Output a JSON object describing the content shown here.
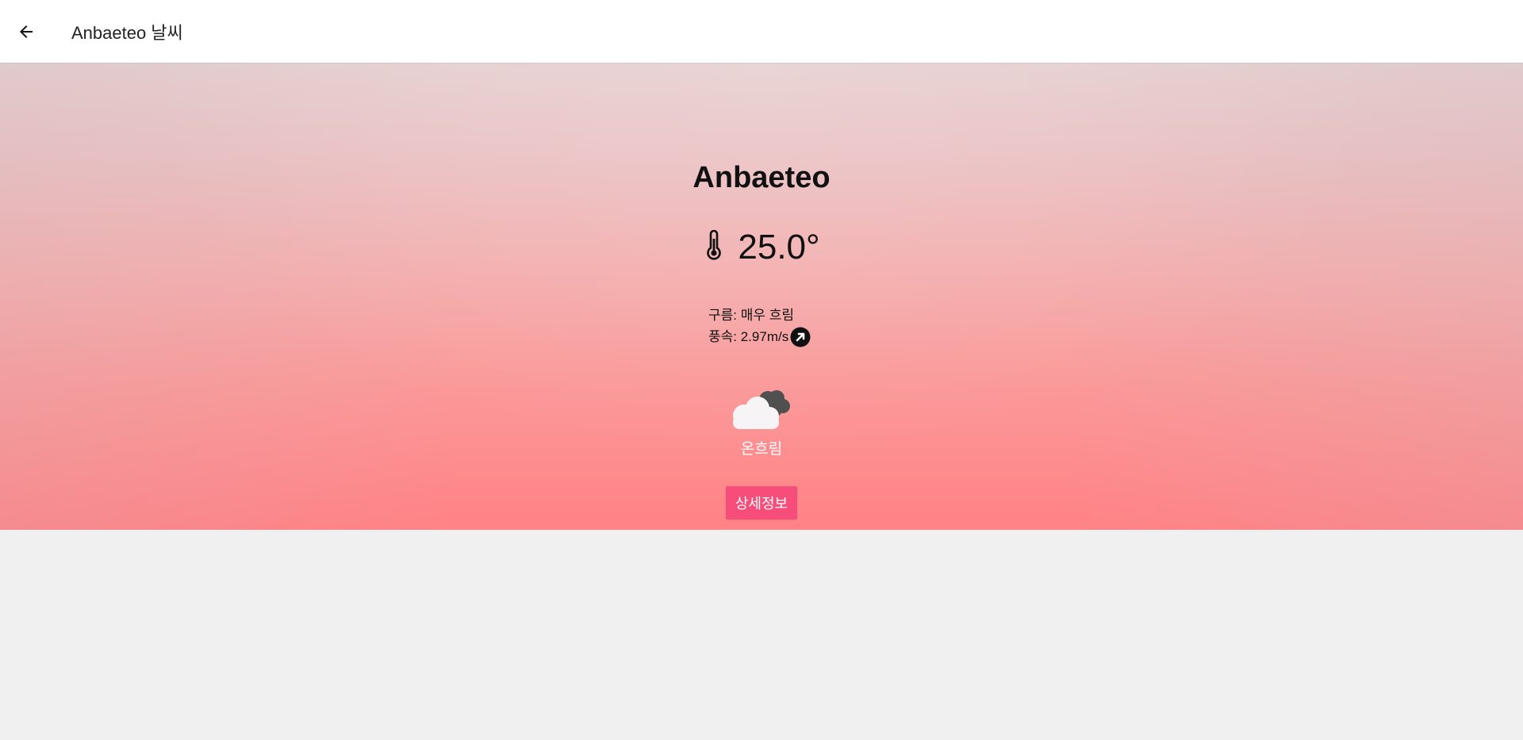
{
  "appbar": {
    "back_icon": "arrow-left-icon",
    "title": "Anbaeteo 날씨"
  },
  "weather": {
    "city": "Anbaeteo",
    "temperature": "25.0°",
    "thermometer_icon": "thermometer-icon",
    "clouds": "구름: 매우 흐림",
    "wind_label": "풍속: 2.97m/s",
    "wind_icon": "wind-direction-arrow-icon",
    "condition_icon": "overcast-clouds-icon",
    "condition": "온흐림",
    "detail_button": "상세정보"
  },
  "colors": {
    "button": "#f74d7a",
    "gradient_top": "#e6cfd0",
    "gradient_bottom": "#ff8286",
    "page_background": "#f0f0f0"
  }
}
